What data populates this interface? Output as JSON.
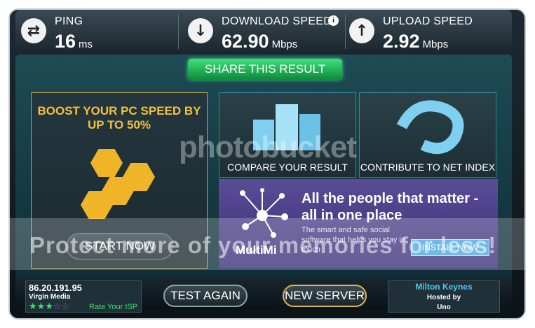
{
  "metrics": {
    "ping": {
      "label": "PING",
      "value": "16",
      "unit": "ms",
      "icon": "swap-arrows-icon"
    },
    "download": {
      "label": "DOWNLOAD SPEED",
      "value": "62.90",
      "unit": "Mbps",
      "icon": "download-arrow-icon",
      "info": "i"
    },
    "upload": {
      "label": "UPLOAD SPEED",
      "value": "2.92",
      "unit": "Mbps",
      "icon": "upload-arrow-icon"
    }
  },
  "share_label": "SHARE THIS RESULT",
  "ad": {
    "headline": "BOOST YOUR PC SPEED BY UP TO 50%",
    "button": "START NOW"
  },
  "tiles": {
    "compare": "COMPARE YOUR RESULT",
    "contribute": "CONTRIBUTE TO NET INDEX"
  },
  "multimi": {
    "logo": "MultiMi",
    "headline": "All the people that matter - all in one place",
    "subtext": "The smart and safe social software that helps you stay in touch",
    "install": "INSTALL NOW"
  },
  "isp": {
    "ip": "86.20.191.95",
    "name": "Virgin Media",
    "rate_label": "Rate Your ISP",
    "rating": 3,
    "max_rating": 5
  },
  "buttons": {
    "test_again": "TEST AGAIN",
    "new_server": "NEW SERVER"
  },
  "server": {
    "city": "Milton Keynes",
    "hosted_by": "Hosted by",
    "host": "Uno"
  },
  "watermark": {
    "brand": "photobucket",
    "tagline": "Protect more of your memories for less!"
  },
  "colors": {
    "accent_green": "#2ee06a",
    "gold": "#f4c13a",
    "teal": "#1e4b55",
    "purple": "#4a3e88"
  }
}
